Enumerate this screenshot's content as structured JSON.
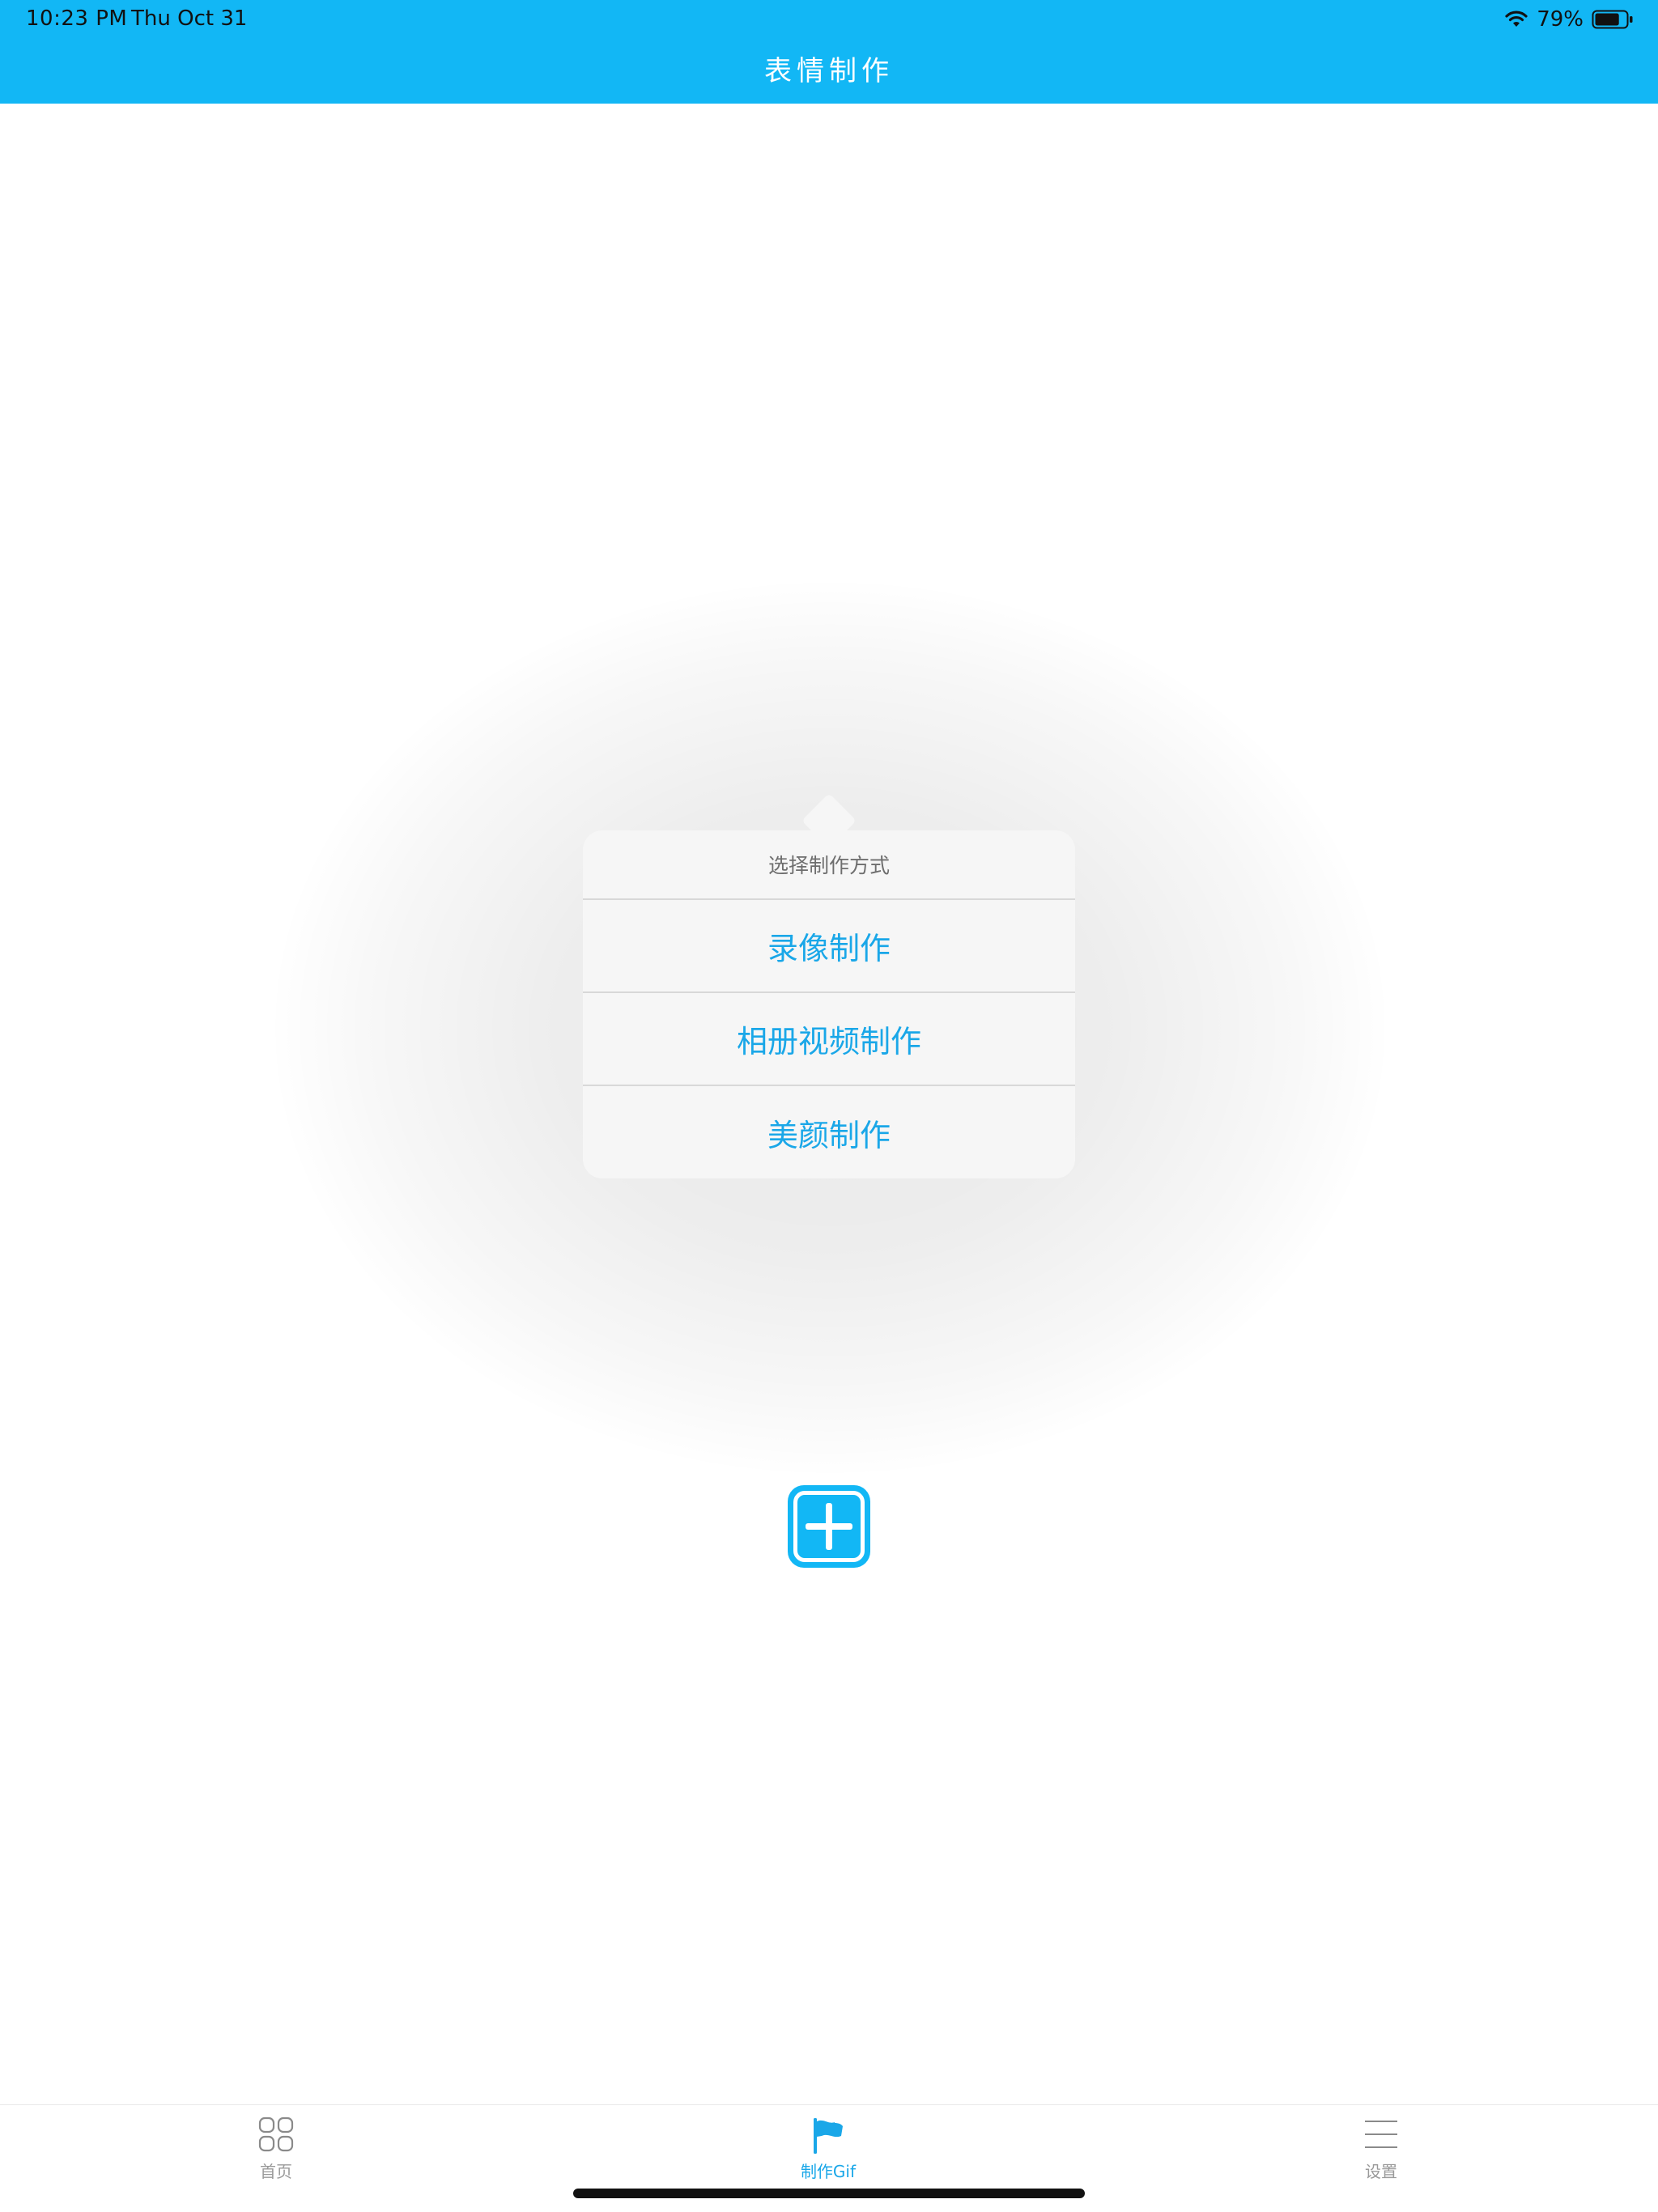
{
  "status_bar": {
    "time": "10:23 PM",
    "date": "Thu Oct 31",
    "battery_percent": "79%",
    "battery_level": 0.79,
    "wifi_icon": "wifi-icon",
    "battery_icon": "battery-icon"
  },
  "nav": {
    "title": "表情制作"
  },
  "popover": {
    "header": "选择制作方式",
    "options": [
      {
        "label": "录像制作"
      },
      {
        "label": "相册视频制作"
      },
      {
        "label": "美颜制作"
      }
    ]
  },
  "add_button": {
    "icon": "plus-icon"
  },
  "tabbar": {
    "tabs": [
      {
        "label": "首页",
        "icon": "grid-icon",
        "active": false
      },
      {
        "label": "制作Gif",
        "icon": "flag-icon",
        "active": true
      },
      {
        "label": "设置",
        "icon": "menu-icon",
        "active": false
      }
    ]
  },
  "colors": {
    "accent": "#12b7f5",
    "link": "#1aa7e8",
    "tab_inactive": "#9a9a9a",
    "popover_bg": "#f6f6f6"
  }
}
